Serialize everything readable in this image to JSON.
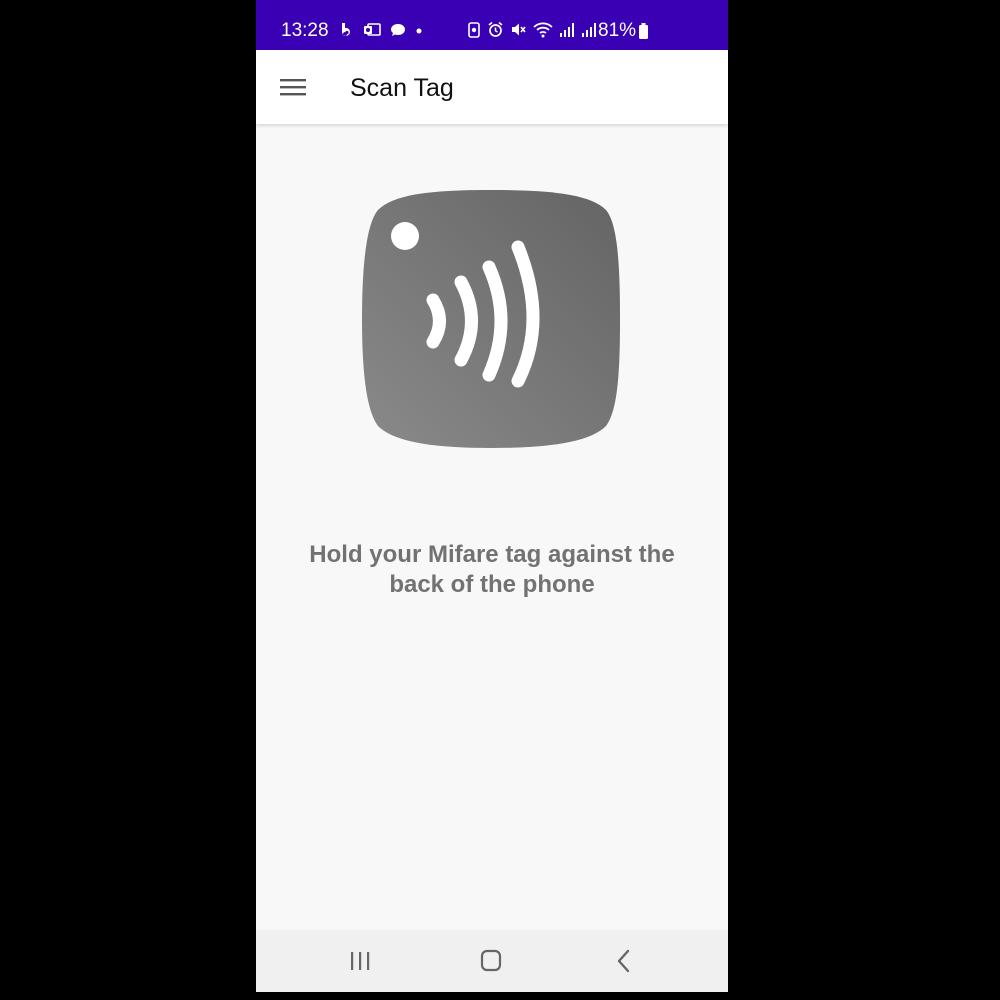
{
  "status_bar": {
    "time": "13:28",
    "battery_percent": "81%",
    "background_color": "#3a00b4",
    "left_icons": [
      "b-app-icon",
      "outlook-icon",
      "chat-bubble-icon",
      "dot-icon"
    ],
    "right_icons": [
      "screenshot-icon",
      "alarm-icon",
      "mute-icon",
      "wifi-icon",
      "signal-icon",
      "signal-icon"
    ]
  },
  "app_bar": {
    "title": "Scan Tag",
    "menu_icon": "hamburger-menu-icon"
  },
  "main": {
    "illustration_icon": "nfc-tag-icon",
    "instruction_line1": "Hold your Mifare tag against the",
    "instruction_line2": "back of the phone"
  },
  "nav_bar": {
    "icons": [
      "recent-apps-icon",
      "home-icon",
      "back-icon"
    ]
  }
}
